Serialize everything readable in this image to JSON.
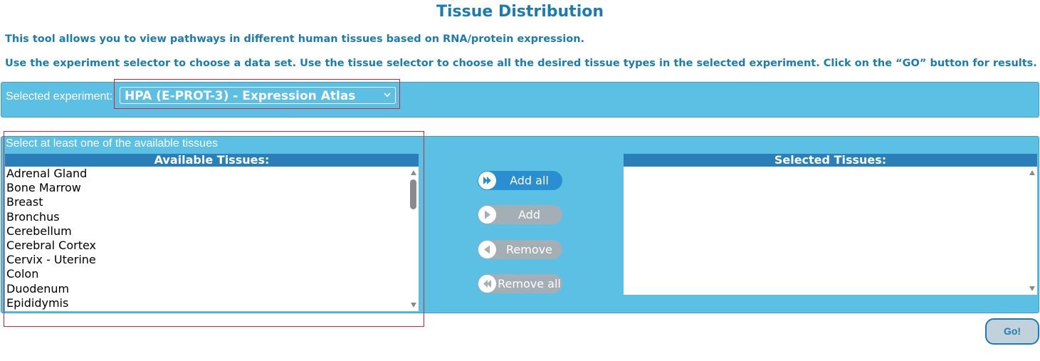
{
  "page": {
    "title": "Tissue Distribution",
    "intro_line1": "This tool allows you to view pathways in different human tissues based on RNA/protein expression.",
    "intro_line2": "Use the experiment selector to choose a data set. Use the tissue selector to choose all the desired tissue types in the selected experiment. Click on the “GO” button for results."
  },
  "experiment": {
    "label": "Selected experiment:",
    "selected_value": "HPA (E-PROT-3) - Expression Atlas"
  },
  "tissues": {
    "hint": "Select at least one of the available tissues",
    "available_header": "Available Tissues:",
    "selected_header": "Selected Tissues:",
    "available_items": [
      "Adrenal Gland",
      "Bone Marrow",
      "Breast",
      "Bronchus",
      "Cerebellum",
      "Cerebral Cortex",
      "Cervix - Uterine",
      "Colon",
      "Duodenum",
      "Epididymis"
    ],
    "selected_items": []
  },
  "buttons": {
    "add_all": "Add all",
    "add": "Add",
    "remove": "Remove",
    "remove_all": "Remove all",
    "go": "Go!"
  },
  "colors": {
    "panel_bg": "#5bc0e3",
    "header_bg": "#2a7fb8",
    "title_text": "#1a7cb0",
    "button_active": "#2a8fd0",
    "button_inactive": "#a3aeb5",
    "highlight_border": "#d9212f"
  },
  "icons": {
    "select_chevron": "chevron-down-icon",
    "add_all": "double-chevron-right-icon",
    "add": "play-right-icon",
    "remove": "play-left-icon",
    "remove_all": "double-chevron-left-icon"
  }
}
